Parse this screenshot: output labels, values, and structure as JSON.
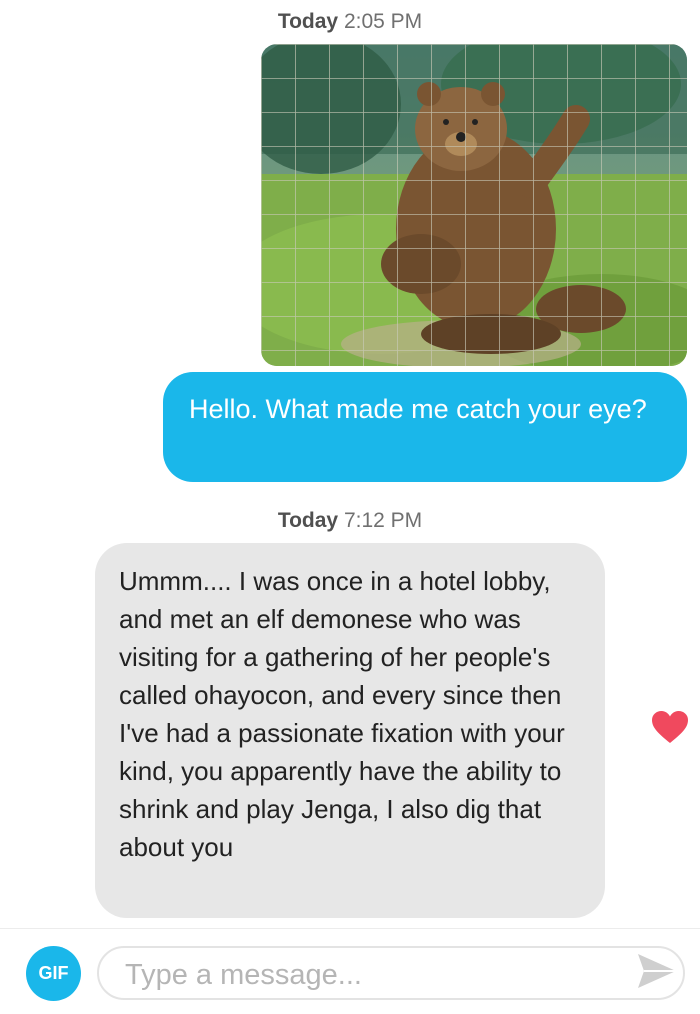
{
  "messages": {
    "first_timestamp": {
      "day": "Today",
      "time": "2:05 PM"
    },
    "sent_text": "Hello. What made me catch your eye?",
    "second_timestamp": {
      "day": "Today",
      "time": "7:12 PM"
    },
    "received_text": "Ummm.... I was once in a hotel lobby, and met an elf demonese who was visiting for a gathering of her people's called ohayocon, and every since then I've had a passionate fixation with your kind, you apparently have the ability to shrink and play Jenga, I also dig that about you"
  },
  "composer": {
    "gif_label": "GIF",
    "placeholder": "Type a message..."
  },
  "colors": {
    "accent_blue": "#1ab7ea",
    "like_red": "#f0495e",
    "incoming_bubble": "#e7e7e7"
  },
  "icons": [
    "heart-icon",
    "send-icon"
  ]
}
